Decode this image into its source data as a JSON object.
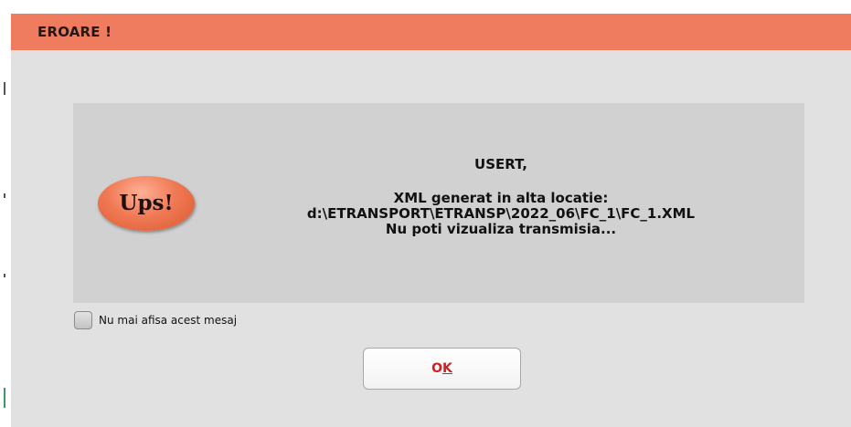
{
  "dialog": {
    "title": "EROARE !",
    "badge_text": "Ups!",
    "message": {
      "greeting": "USERT,",
      "line1": "XML generat in alta locatie:",
      "path": "d:\\ETRANSPORT\\ETRANSP\\2022_06\\FC_1\\FC_1.XML",
      "line3": "Nu poti vizualiza transmisia..."
    },
    "checkbox": {
      "label": "Nu mai afisa acest mesaj",
      "checked": false
    },
    "ok_button": {
      "label_prefix": "O",
      "label_mnemonic": "K"
    }
  },
  "colors": {
    "title_bar": "#ef7c5f",
    "dialog_bg": "#e1e1e1",
    "panel_bg": "#d1d1d1",
    "ok_text": "#d12020"
  }
}
